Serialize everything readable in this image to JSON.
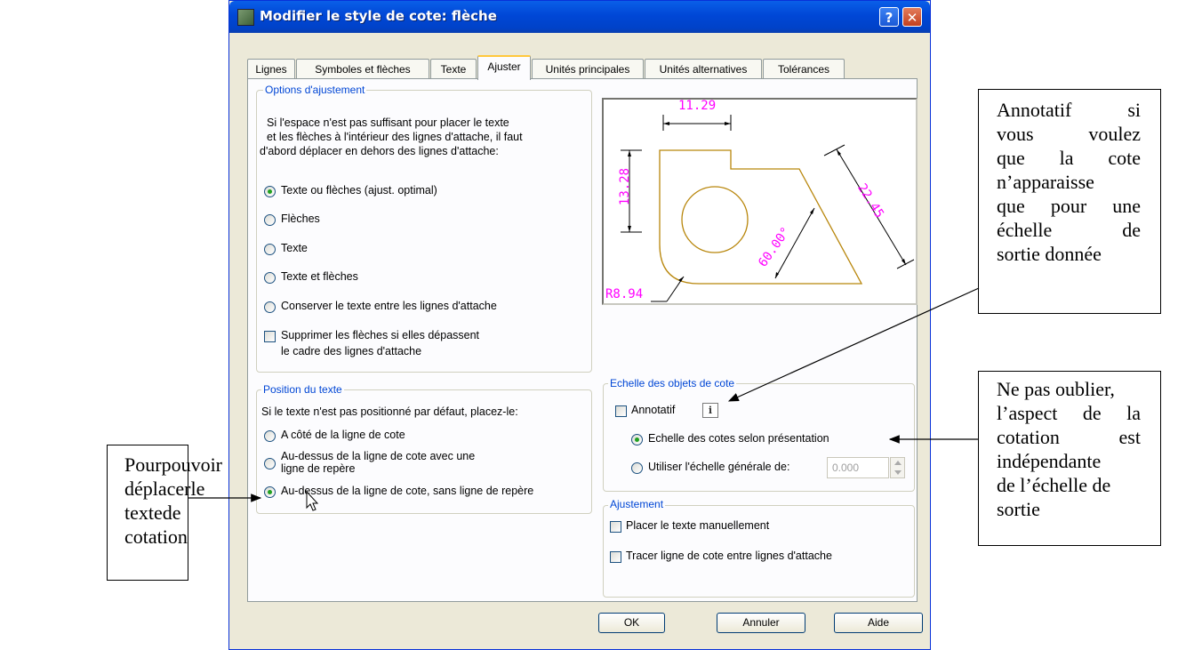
{
  "window": {
    "title": "Modifier le style de cote: flèche",
    "help": "?",
    "close": "✕"
  },
  "tabs": [
    "Lignes",
    "Symboles et flèches",
    "Texte",
    "Ajuster",
    "Unités principales",
    "Unités alternatives",
    "Tolérances"
  ],
  "options": {
    "legend": "Options d'ajustement",
    "desc1": "Si l'espace n'est pas suffisant pour placer le texte",
    "desc2": "et les flèches à l'intérieur des lignes d'attache, il faut",
    "desc3": "d'abord déplacer en dehors des lignes d'attache:",
    "radios": [
      "Texte ou flèches (ajust. optimal)",
      "Flèches",
      "Texte",
      "Texte et flèches",
      "Conserver le texte entre les lignes d'attache"
    ],
    "suppress1": "Supprimer les flèches si elles dépassent",
    "suppress2": "le cadre des lignes d'attache"
  },
  "position": {
    "legend": "Position du texte",
    "desc": "Si le texte n'est pas positionné par défaut, placez-le:",
    "r1": "A côté de la ligne de cote",
    "r2a": "Au-dessus de la ligne de cote avec une",
    "r2b": "ligne de repère",
    "r3": "Au-dessus de la ligne de cote, sans ligne de repère"
  },
  "preview": {
    "d1": "11.29",
    "d2": "13.28",
    "d3": "22.45",
    "d4": "60.00°",
    "d5": "R8.94",
    "dim_color": "#ff00ff",
    "geom_color": "#b8860b"
  },
  "scale": {
    "legend": "Echelle des objets de cote",
    "annotatif": "Annotatif",
    "info": "i",
    "r1": "Echelle des cotes selon présentation",
    "r2": "Utiliser l'échelle générale de:",
    "value": "0.000"
  },
  "fine": {
    "legend": "Ajustement",
    "c1": "Placer le texte manuellement",
    "c2": "Tracer ligne de cote entre lignes d'attache"
  },
  "buttons": {
    "ok": "OK",
    "cancel": "Annuler",
    "help": "Aide"
  },
  "notes": {
    "right_top": [
      [
        "Annotatif",
        "si"
      ],
      [
        "vous",
        "voulez"
      ],
      [
        "que",
        "la",
        "cote"
      ],
      [
        "n’apparaisse"
      ],
      [
        "que",
        "pour",
        "une"
      ],
      [
        "échelle",
        "de"
      ],
      [
        "sortie donnée"
      ]
    ],
    "right_mid": [
      [
        "Ne pas oublier,"
      ],
      [
        "l’aspect",
        "de",
        "la"
      ],
      [
        "cotation",
        "est"
      ],
      [
        "indépendante"
      ],
      [
        "de l’échelle de"
      ],
      [
        "sortie"
      ]
    ],
    "left": [
      [
        "Pour",
        "pouvoir"
      ],
      [
        "déplacer",
        "le"
      ],
      [
        "texte",
        "de"
      ],
      [
        "cotation"
      ]
    ]
  }
}
